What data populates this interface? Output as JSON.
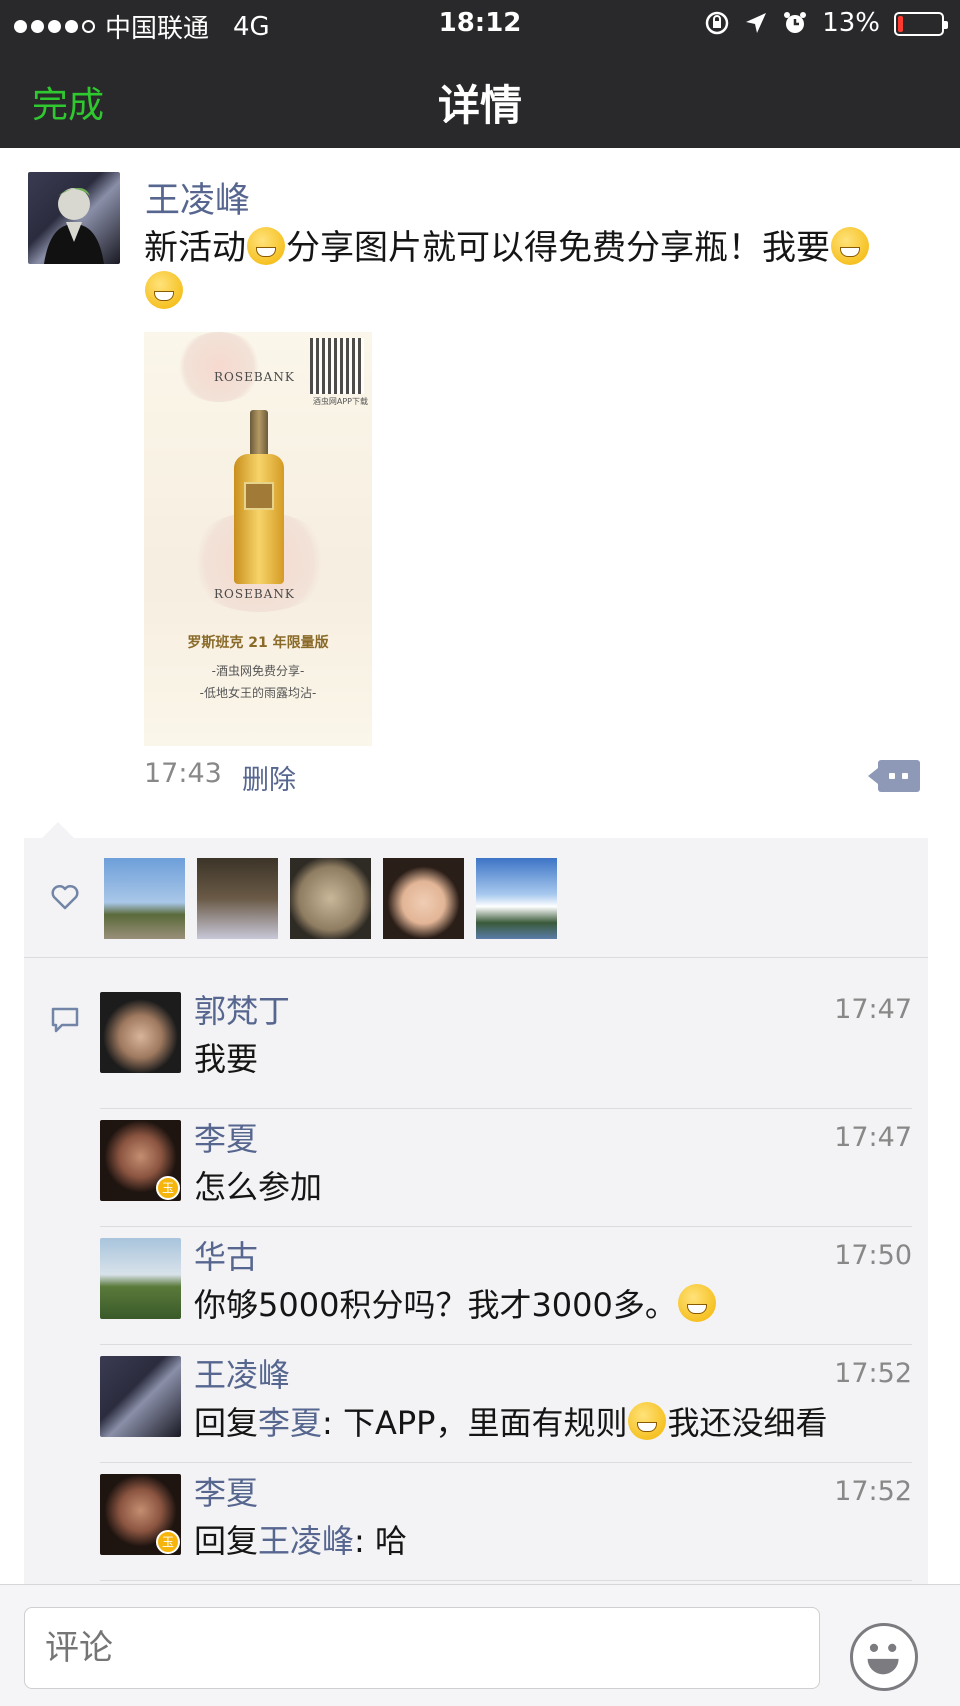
{
  "status_bar": {
    "carrier": "中国联通",
    "network": "4G",
    "time": "18:12",
    "battery": "13%",
    "battery_level": 0.13
  },
  "nav": {
    "done_label": "完成",
    "title": "详情"
  },
  "post": {
    "author": "王凌峰",
    "text_part1": "新活动",
    "text_part2": "分享图片就可以得免费分享瓶！我要",
    "image": {
      "brand_top": "ROSEBANK",
      "brand_bottom": "ROSEBANK",
      "qr_label": "酒虫网APP下载",
      "title": "罗斯班克 21 年限量版",
      "line1": "-酒虫网免费分享-",
      "line2": "-低地女王的雨露均沾-"
    },
    "time": "17:43",
    "delete_label": "删除"
  },
  "likes": {
    "icon": "heart-icon",
    "liker_count": 5
  },
  "comments": [
    {
      "name": "郭梵丁",
      "time": "17:47",
      "text": "我要"
    },
    {
      "name": "李夏",
      "time": "17:47",
      "text": "怎么参加"
    },
    {
      "name": "华古",
      "time": "17:50",
      "text": "你够5000积分吗？我才3000多。"
    },
    {
      "name": "王凌峰",
      "time": "17:52",
      "reply_prefix": "回复",
      "reply_to": "李夏",
      "text": ": 下APP，里面有规则",
      "text_after": "我还没细看"
    },
    {
      "name": "李夏",
      "time": "17:52",
      "reply_prefix": "回复",
      "reply_to": "王凌峰",
      "text": ": 哈"
    }
  ],
  "input": {
    "placeholder": "评论"
  },
  "colors": {
    "nav_bg": "#29292b",
    "accent_green": "#2fc82f",
    "link_blue": "#56668f",
    "panel_bg": "#f3f3f5"
  }
}
